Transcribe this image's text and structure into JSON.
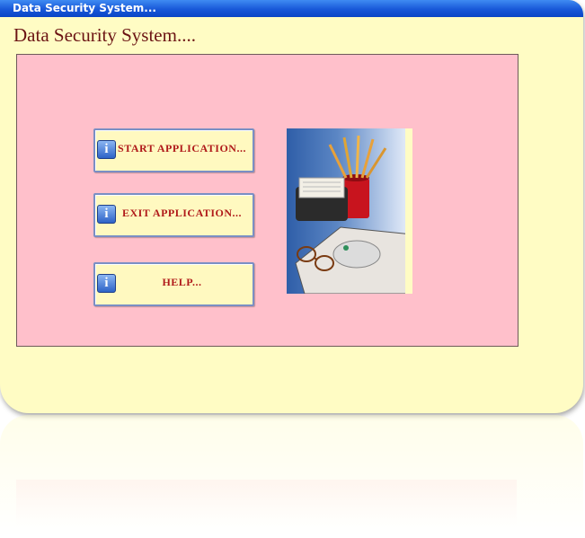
{
  "window": {
    "title": "Data Security System..."
  },
  "header": {
    "title": "Data Security System...."
  },
  "menu": {
    "buttons": [
      {
        "label": "START APPLICATION...",
        "icon": "info-icon"
      },
      {
        "label": "EXIT APPLICATION...",
        "icon": "info-icon"
      },
      {
        "label": "HELP...",
        "icon": "info-icon"
      }
    ]
  },
  "colors": {
    "window_bg": "#fffcc4",
    "panel_bg": "#ffc0cb",
    "title_bar": "#1858d8",
    "header_text": "#6b1414",
    "button_text": "#b01a1a"
  }
}
